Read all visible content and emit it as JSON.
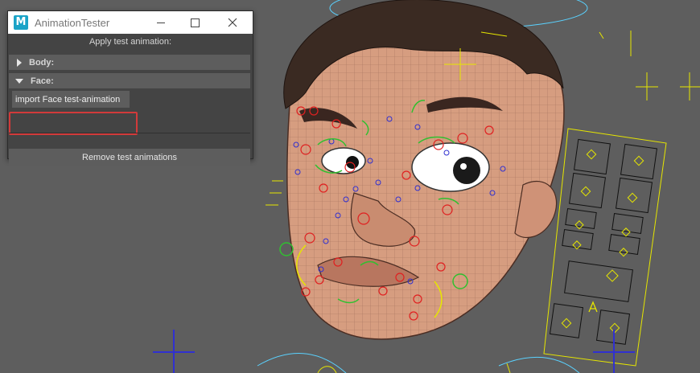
{
  "window": {
    "title": "AnimationTester",
    "app_icon_letter": "M"
  },
  "panel": {
    "apply_label": "Apply test animation:",
    "frames": [
      {
        "label": "Body:",
        "collapsed": true
      },
      {
        "label": "Face:",
        "collapsed": false
      }
    ],
    "import_face_button": "import Face test-animation",
    "remove_button": "Remove test animations"
  },
  "colors": {
    "highlight_border": "#d23a3a",
    "panel_bg": "#444444",
    "frame_bg": "#5d5d5d",
    "viewport_bg": "#5e5e5e",
    "skin": "#d69d80",
    "hair": "#3a2a22",
    "control_red": "#e02020",
    "control_blue": "#3030d0",
    "control_green": "#30c030",
    "control_yellow": "#e6e600",
    "control_cyan": "#5ad2ff"
  },
  "icons": {
    "app": "maya-icon",
    "minimize": "minimize-icon",
    "maximize": "maximize-icon",
    "close": "close-icon",
    "frame_collapsed": "triangle-right-icon",
    "frame_expanded": "triangle-down-icon"
  }
}
